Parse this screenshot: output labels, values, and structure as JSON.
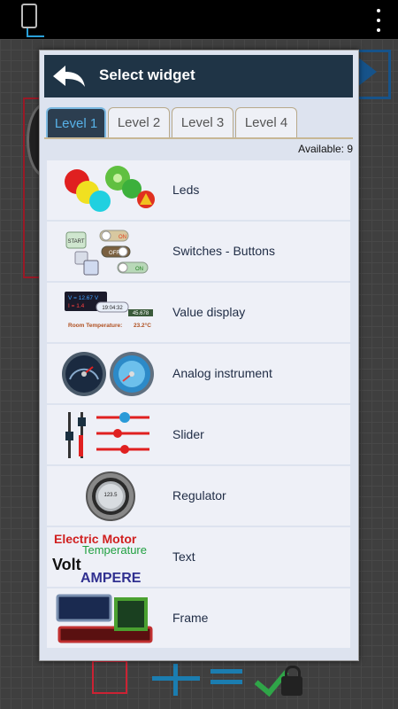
{
  "topbar": {
    "menu_icon": "more-vert-icon"
  },
  "dialog": {
    "title": "Select widget",
    "tabs": [
      {
        "label": "Level 1"
      },
      {
        "label": "Level 2"
      },
      {
        "label": "Level 3"
      },
      {
        "label": "Level 4"
      }
    ],
    "available_label": "Available: 9",
    "widgets": [
      {
        "label": "Leds",
        "icon": "leds-icon"
      },
      {
        "label": "Switches - Buttons",
        "icon": "switches-icon"
      },
      {
        "label": "Value display",
        "icon": "value-display-icon"
      },
      {
        "label": "Analog instrument",
        "icon": "gauge-icon"
      },
      {
        "label": "Slider",
        "icon": "slider-icon"
      },
      {
        "label": "Regulator",
        "icon": "knob-icon"
      },
      {
        "label": "Text",
        "icon": "text-icon"
      },
      {
        "label": "Frame",
        "icon": "frame-icon"
      }
    ],
    "thumbs": {
      "switch_start": "START",
      "switch_on": "ON",
      "switch_off": "OFF",
      "vd_v": "V = 12.67 V",
      "vd_i": "I = 1.4",
      "vd_time": "19:04:32",
      "vd_num": "45.678",
      "vd_room": "Room Temperature:",
      "vd_temp": "23.2°C",
      "reg_value": "123.5",
      "txt_motor": "Electric Motor",
      "txt_temp": "Temperature",
      "txt_volt": "Volt",
      "txt_ampere": "AMPERE"
    }
  },
  "colors": {
    "header": "#1f3446",
    "tab_active_text": "#58b2e8",
    "accent_blue": "#1b7db0"
  }
}
